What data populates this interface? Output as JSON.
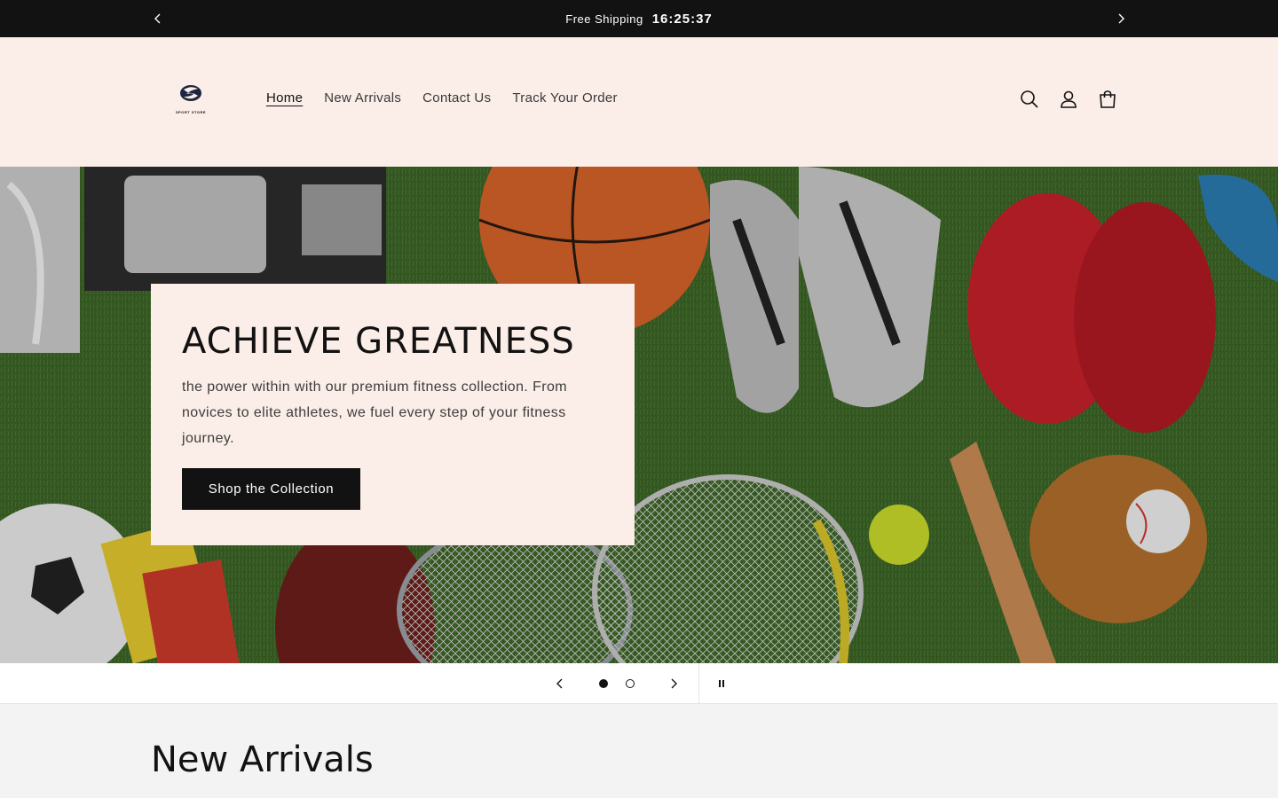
{
  "announcement": {
    "message": "Free Shipping",
    "countdown": "16:25:37",
    "prev_icon": "chevron-left-icon",
    "next_icon": "chevron-right-icon"
  },
  "header": {
    "logo_text": "SPORT STORE",
    "nav": [
      {
        "label": "Home",
        "active": true
      },
      {
        "label": "New Arrivals",
        "active": false
      },
      {
        "label": "Contact Us",
        "active": false
      },
      {
        "label": "Track Your Order",
        "active": false
      }
    ],
    "icons": [
      "search-icon",
      "account-icon",
      "cart-icon"
    ]
  },
  "hero": {
    "title": "ACHIEVE GREATNESS",
    "text": "the power within with our premium fitness collection. From novices to elite athletes, we fuel every step of your fitness journey.",
    "button": "Shop the Collection"
  },
  "slider": {
    "slides": 2,
    "current": 1
  },
  "section": {
    "title": "New Arrivals"
  },
  "colors": {
    "announcement_bg": "#121212",
    "header_bg": "#fbede7",
    "button_bg": "#121212",
    "page_bg": "#f3f3f3"
  }
}
